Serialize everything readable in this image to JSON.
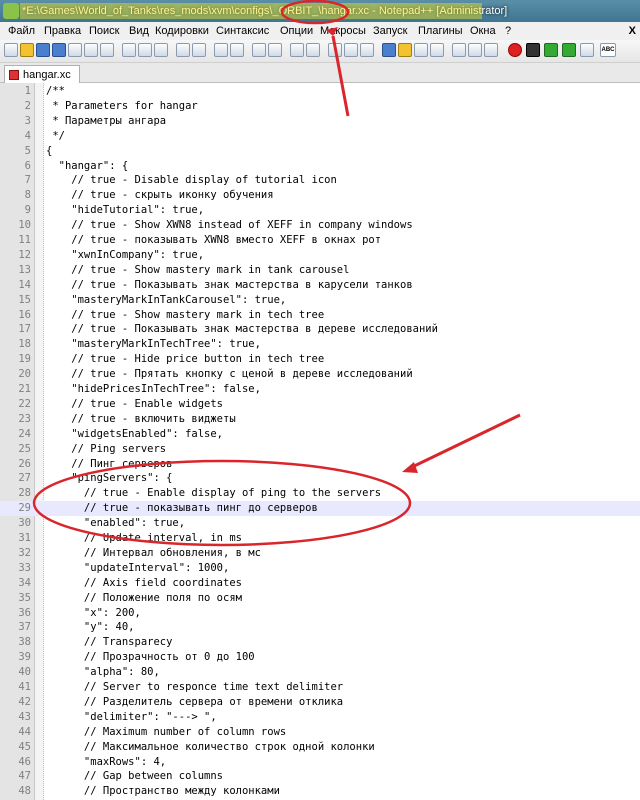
{
  "window": {
    "title": "*E:\\Games\\World_of_Tanks\\res_mods\\xvm\\configs\\_ORBIT_\\hangar.xc - Notepad++ [Administrator]"
  },
  "menu": {
    "items": [
      "Файл",
      "Правка",
      "Поиск",
      "Вид",
      "Кодировки",
      "Синтаксис",
      "Опции",
      "Макросы",
      "Запуск",
      "Плагины",
      "Окна",
      "?"
    ],
    "close": "X"
  },
  "toolbar": {
    "spell_check_label": "ABC"
  },
  "tabs": [
    {
      "label": "hangar.xc"
    }
  ],
  "editor": {
    "current_line": 29,
    "lines": [
      "/**",
      " * Parameters for hangar",
      " * Параметры ангара",
      " */",
      "{",
      "  \"hangar\": {",
      "    // true - Disable display of tutorial icon",
      "    // true - скрыть иконку обучения",
      "    \"hideTutorial\": true,",
      "    // true - Show XWN8 instead of XEFF in company windows",
      "    // true - показывать XWN8 вместо XEFF в окнах рот",
      "    \"xwnInCompany\": true,",
      "    // true - Show mastery mark in tank carousel",
      "    // true - Показывать знак мастерства в карусели танков",
      "    \"masteryMarkInTankCarousel\": true,",
      "    // true - Show mastery mark in tech tree",
      "    // true - Показывать знак мастерства в дереве исследований",
      "    \"masteryMarkInTechTree\": true,",
      "    // true - Hide price button in tech tree",
      "    // true - Прятать кнопку с ценой в дереве исследований",
      "    \"hidePricesInTechTree\": false,",
      "    // true - Enable widgets",
      "    // true - включить виджеты",
      "    \"widgetsEnabled\": false,",
      "    // Ping servers",
      "    // Пинг серверов",
      "    \"pingServers\": {",
      "      // true - Enable display of ping to the servers",
      "      // true - показывать пинг до серверов",
      "      \"enabled\": true,",
      "      // Update interval, in ms",
      "      // Интервал обновления, в мс",
      "      \"updateInterval\": 1000,",
      "      // Axis field coordinates",
      "      // Положение поля по осям",
      "      \"x\": 200,",
      "      \"y\": 40,",
      "      // Transparecy",
      "      // Прозрачность от 0 до 100",
      "      \"alpha\": 80,",
      "      // Server to responce time text delimiter",
      "      // Разделитель сервера от времени отклика",
      "      \"delimiter\": \"---> \",",
      "      // Maximum number of column rows",
      "      // Максимальное количество строк одной колонки",
      "      \"maxRows\": 4,",
      "      // Gap between columns",
      "      // Пространство между колонками"
    ]
  },
  "colors": {
    "annotation_red": "#d9262c",
    "highlight_yellow": "#f5e619"
  }
}
